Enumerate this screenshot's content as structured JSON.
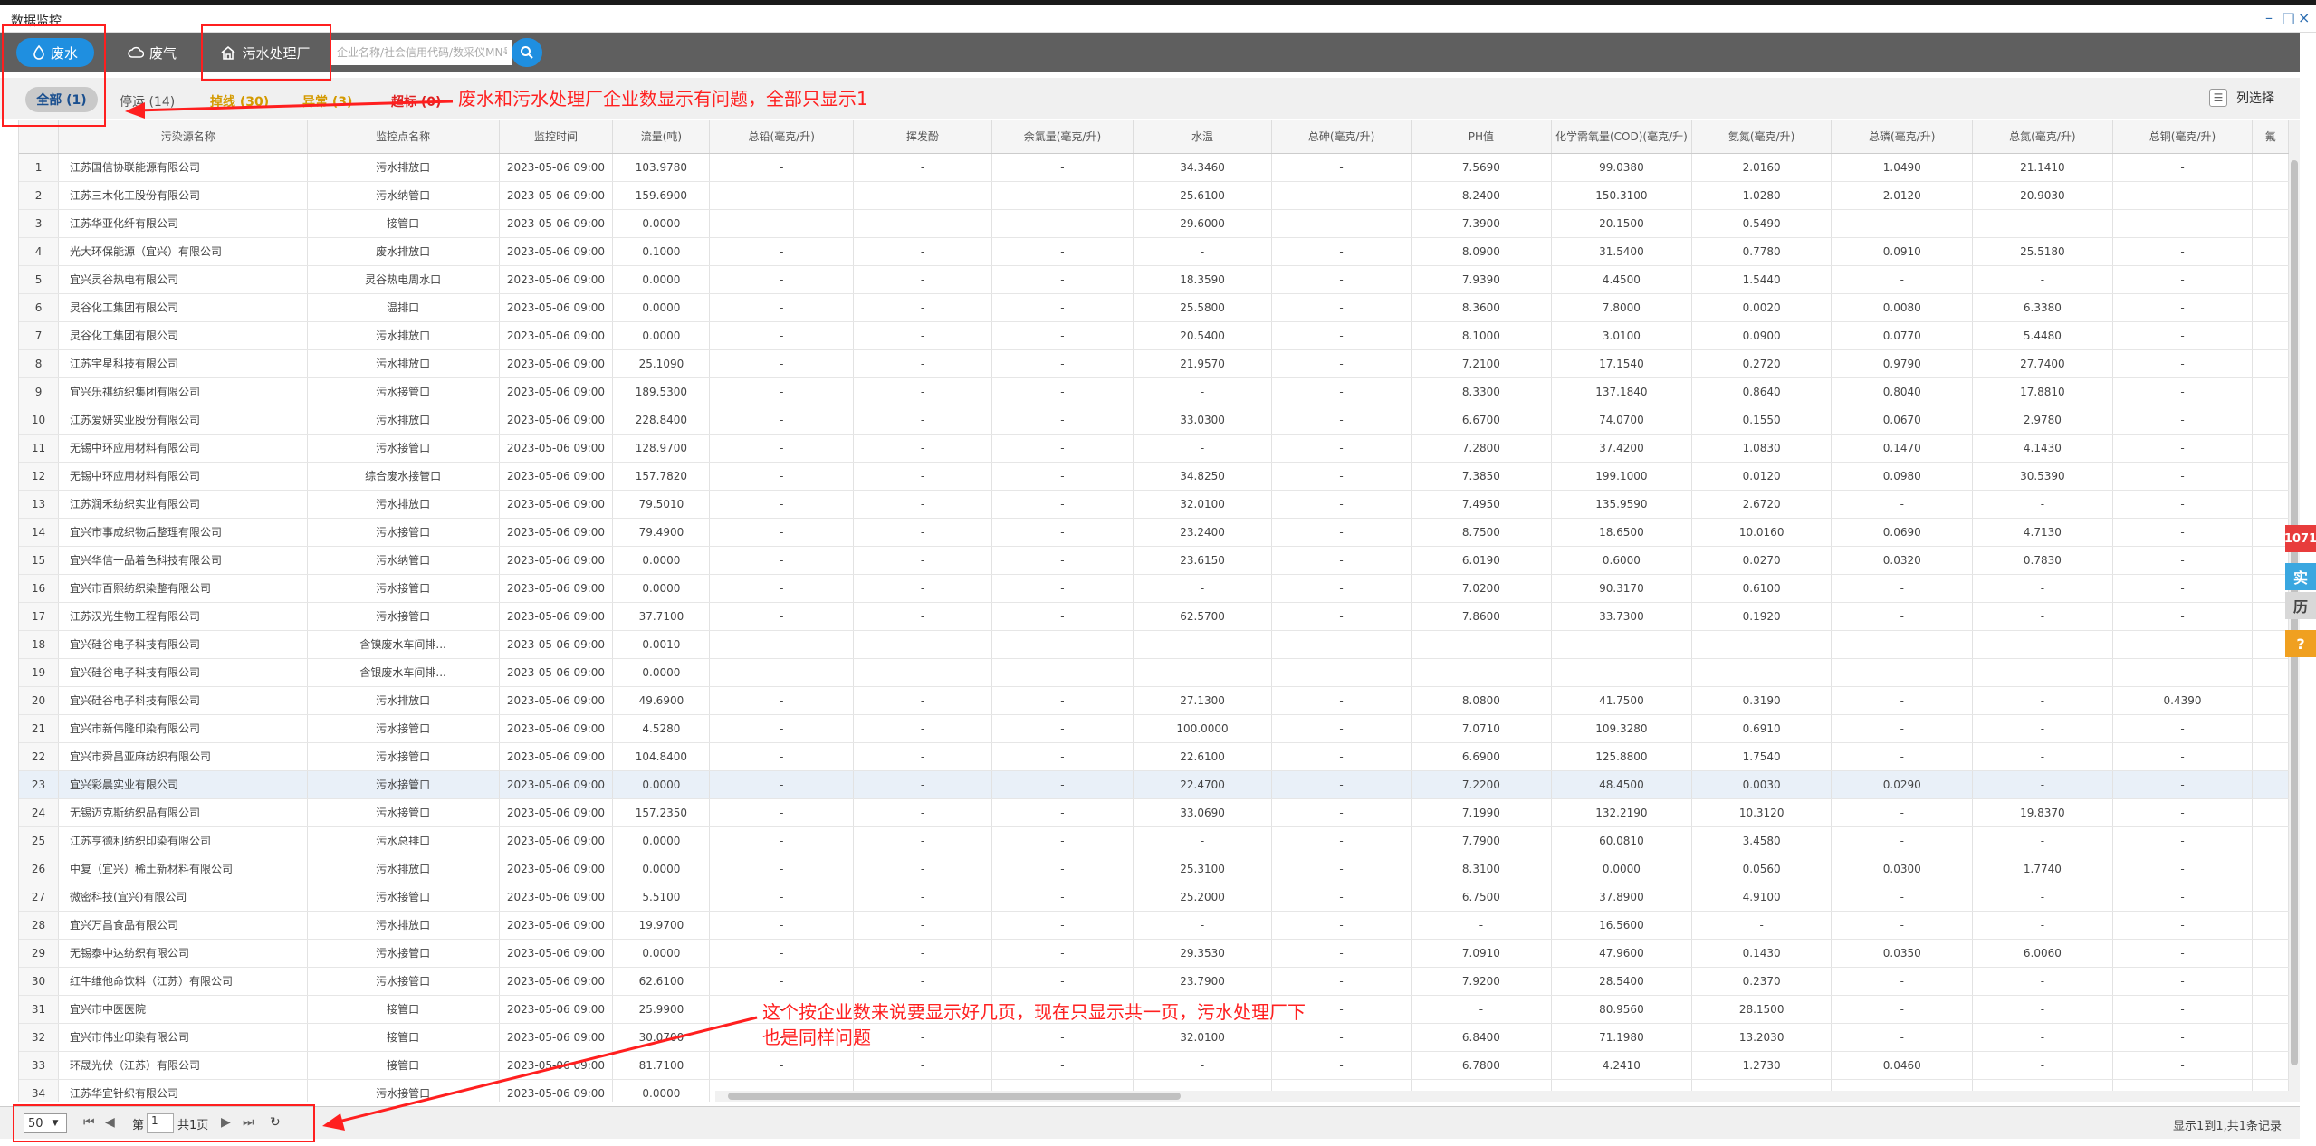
{
  "window": {
    "title": "数据监控",
    "minimize": "–",
    "restore": "□",
    "close": "×"
  },
  "toolbar": {
    "tab_wastewater": "废水",
    "tab_exhaust": "废气",
    "tab_plant": "污水处理厂",
    "search_placeholder": "企业名称/社会信用代码/数采仪MN号"
  },
  "filters": {
    "all": "全部 (1)",
    "stopped": "停运 (14)",
    "offline": "掉线 (30)",
    "abnormal": "异常 (3)",
    "exceed": "超标 (0)",
    "column_select": "列选择",
    "colors": {
      "stopped": "#555555",
      "offline": "#d49a00",
      "abnormal": "#d49a00",
      "exceed": "#e02020"
    }
  },
  "table": {
    "headers": [
      "",
      "污染源名称",
      "监控点名称",
      "监控时间",
      "流量(吨)",
      "总铅(毫克/升)",
      "挥发酚",
      "余氯量(毫克/升)",
      "水温",
      "总砷(毫克/升)",
      "PH值",
      "化学需氧量(COD)(毫克/升)",
      "氨氮(毫克/升)",
      "总磷(毫克/升)",
      "总氮(毫克/升)",
      "总铜(毫克/升)",
      "氟"
    ],
    "rows": [
      [
        "1",
        "江苏国信协联能源有限公司",
        "污水排放口",
        "2023-05-06 09:00",
        "103.9780",
        "-",
        "-",
        "-",
        "34.3460",
        "-",
        "7.5690",
        "99.0380",
        "2.0160",
        "1.0490",
        "21.1410",
        "-"
      ],
      [
        "2",
        "江苏三木化工股份有限公司",
        "污水纳管口",
        "2023-05-06 09:00",
        "159.6900",
        "-",
        "-",
        "-",
        "25.6100",
        "-",
        "8.2400",
        "150.3100",
        "1.0280",
        "2.0120",
        "20.9030",
        "-"
      ],
      [
        "3",
        "江苏华亚化纤有限公司",
        "接管口",
        "2023-05-06 09:00",
        "0.0000",
        "-",
        "-",
        "-",
        "29.6000",
        "-",
        "7.3900",
        "20.1500",
        "0.5490",
        "-",
        "-",
        "-"
      ],
      [
        "4",
        "光大环保能源（宜兴）有限公司",
        "废水排放口",
        "2023-05-06 09:00",
        "0.1000",
        "-",
        "-",
        "-",
        "-",
        "-",
        "8.0900",
        "31.5400",
        "0.7780",
        "0.0910",
        "25.5180",
        "-"
      ],
      [
        "5",
        "宜兴灵谷热电有限公司",
        "灵谷热电周水口",
        "2023-05-06 09:00",
        "0.0000",
        "-",
        "-",
        "-",
        "18.3590",
        "-",
        "7.9390",
        "4.4500",
        "1.5440",
        "-",
        "-",
        "-"
      ],
      [
        "6",
        "灵谷化工集团有限公司",
        "温排口",
        "2023-05-06 09:00",
        "0.0000",
        "-",
        "-",
        "-",
        "25.5800",
        "-",
        "8.3600",
        "7.8000",
        "0.0020",
        "0.0080",
        "6.3380",
        "-"
      ],
      [
        "7",
        "灵谷化工集团有限公司",
        "污水排放口",
        "2023-05-06 09:00",
        "0.0000",
        "-",
        "-",
        "-",
        "20.5400",
        "-",
        "8.1000",
        "3.0100",
        "0.0900",
        "0.0770",
        "5.4480",
        "-"
      ],
      [
        "8",
        "江苏宇星科技有限公司",
        "污水排放口",
        "2023-05-06 09:00",
        "25.1090",
        "-",
        "-",
        "-",
        "21.9570",
        "-",
        "7.2100",
        "17.1540",
        "0.2720",
        "0.9790",
        "27.7400",
        "-"
      ],
      [
        "9",
        "宜兴乐祺纺织集团有限公司",
        "污水接管口",
        "2023-05-06 09:00",
        "189.5300",
        "-",
        "-",
        "-",
        "-",
        "-",
        "8.3300",
        "137.1840",
        "0.8640",
        "0.8040",
        "17.8810",
        "-"
      ],
      [
        "10",
        "江苏爱妍实业股份有限公司",
        "污水排放口",
        "2023-05-06 09:00",
        "228.8400",
        "-",
        "-",
        "-",
        "33.0300",
        "-",
        "6.6700",
        "74.0700",
        "0.1550",
        "0.0670",
        "2.9780",
        "-"
      ],
      [
        "11",
        "无锡中环应用材料有限公司",
        "污水接管口",
        "2023-05-06 09:00",
        "128.9700",
        "-",
        "-",
        "-",
        "-",
        "-",
        "7.2800",
        "37.4200",
        "1.0830",
        "0.1470",
        "4.1430",
        "-"
      ],
      [
        "12",
        "无锡中环应用材料有限公司",
        "综合废水接管口",
        "2023-05-06 09:00",
        "157.7820",
        "-",
        "-",
        "-",
        "34.8250",
        "-",
        "7.3850",
        "199.1000",
        "0.0120",
        "0.0980",
        "30.5390",
        "-"
      ],
      [
        "13",
        "江苏润禾纺织实业有限公司",
        "污水排放口",
        "2023-05-06 09:00",
        "79.5010",
        "-",
        "-",
        "-",
        "32.0100",
        "-",
        "7.4950",
        "135.9590",
        "2.6720",
        "-",
        "-",
        "-"
      ],
      [
        "14",
        "宜兴市事成织物后整理有限公司",
        "污水接管口",
        "2023-05-06 09:00",
        "79.4900",
        "-",
        "-",
        "-",
        "23.2400",
        "-",
        "8.7500",
        "18.6500",
        "10.0160",
        "0.0690",
        "4.7130",
        "-"
      ],
      [
        "15",
        "宜兴华信一品着色科技有限公司",
        "污水纳管口",
        "2023-05-06 09:00",
        "0.0000",
        "-",
        "-",
        "-",
        "23.6150",
        "-",
        "6.0190",
        "0.6000",
        "0.0270",
        "0.0320",
        "0.7830",
        "-"
      ],
      [
        "16",
        "宜兴市百熙纺织染整有限公司",
        "污水接管口",
        "2023-05-06 09:00",
        "0.0000",
        "-",
        "-",
        "-",
        "-",
        "-",
        "7.0200",
        "90.3170",
        "0.6100",
        "-",
        "-",
        "-"
      ],
      [
        "17",
        "江苏汉光生物工程有限公司",
        "污水接管口",
        "2023-05-06 09:00",
        "37.7100",
        "-",
        "-",
        "-",
        "62.5700",
        "-",
        "7.8600",
        "33.7300",
        "0.1920",
        "-",
        "-",
        "-"
      ],
      [
        "18",
        "宜兴硅谷电子科技有限公司",
        "含镍废水车间排...",
        "2023-05-06 09:00",
        "0.0010",
        "-",
        "-",
        "-",
        "-",
        "-",
        "-",
        "-",
        "-",
        "-",
        "-",
        "-"
      ],
      [
        "19",
        "宜兴硅谷电子科技有限公司",
        "含银废水车间排...",
        "2023-05-06 09:00",
        "0.0000",
        "-",
        "-",
        "-",
        "-",
        "-",
        "-",
        "-",
        "-",
        "-",
        "-",
        "-"
      ],
      [
        "20",
        "宜兴硅谷电子科技有限公司",
        "污水排放口",
        "2023-05-06 09:00",
        "49.6900",
        "-",
        "-",
        "-",
        "27.1300",
        "-",
        "8.0800",
        "41.7500",
        "0.3190",
        "-",
        "-",
        "0.4390"
      ],
      [
        "21",
        "宜兴市新伟隆印染有限公司",
        "污水接管口",
        "2023-05-06 09:00",
        "4.5280",
        "-",
        "-",
        "-",
        "100.0000",
        "-",
        "7.0710",
        "109.3280",
        "0.6910",
        "-",
        "-",
        "-"
      ],
      [
        "22",
        "宜兴市舜昌亚麻纺织有限公司",
        "污水接管口",
        "2023-05-06 09:00",
        "104.8400",
        "-",
        "-",
        "-",
        "22.6100",
        "-",
        "6.6900",
        "125.8800",
        "1.7540",
        "-",
        "-",
        "-"
      ],
      [
        "23",
        "宜兴彩晨实业有限公司",
        "污水接管口",
        "2023-05-06 09:00",
        "0.0000",
        "-",
        "-",
        "-",
        "22.4700",
        "-",
        "7.2200",
        "48.4500",
        "0.0030",
        "0.0290",
        "-",
        "-"
      ],
      [
        "24",
        "无锡迈克斯纺织品有限公司",
        "污水接管口",
        "2023-05-06 09:00",
        "157.2350",
        "-",
        "-",
        "-",
        "33.0690",
        "-",
        "7.1990",
        "132.2190",
        "10.3120",
        "-",
        "19.8370",
        "-"
      ],
      [
        "25",
        "江苏亨德利纺织印染有限公司",
        "污水总排口",
        "2023-05-06 09:00",
        "0.0000",
        "-",
        "-",
        "-",
        "-",
        "-",
        "7.7900",
        "60.0810",
        "3.4580",
        "-",
        "-",
        "-"
      ],
      [
        "26",
        "中复（宜兴）稀土新材料有限公司",
        "污水排放口",
        "2023-05-06 09:00",
        "0.0000",
        "-",
        "-",
        "-",
        "25.3100",
        "-",
        "8.3100",
        "0.0000",
        "0.0560",
        "0.0300",
        "1.7740",
        "-"
      ],
      [
        "27",
        "微密科技(宜兴)有限公司",
        "污水接管口",
        "2023-05-06 09:00",
        "5.5100",
        "-",
        "-",
        "-",
        "25.2000",
        "-",
        "6.7500",
        "37.8900",
        "4.9100",
        "-",
        "-",
        "-"
      ],
      [
        "28",
        "宜兴万昌食品有限公司",
        "污水排放口",
        "2023-05-06 09:00",
        "19.9700",
        "-",
        "-",
        "-",
        "-",
        "-",
        "-",
        "16.5600",
        "-",
        "-",
        "-",
        "-"
      ],
      [
        "29",
        "无锡泰中达纺织有限公司",
        "污水接管口",
        "2023-05-06 09:00",
        "0.0000",
        "-",
        "-",
        "-",
        "29.3530",
        "-",
        "7.0910",
        "47.9600",
        "0.1430",
        "0.0350",
        "6.0060",
        "-"
      ],
      [
        "30",
        "红牛维他命饮料（江苏）有限公司",
        "污水接管口",
        "2023-05-06 09:00",
        "62.6100",
        "-",
        "-",
        "-",
        "23.7900",
        "-",
        "7.9200",
        "28.5400",
        "0.2370",
        "-",
        "-",
        "-"
      ],
      [
        "31",
        "宜兴市中医医院",
        "接管口",
        "2023-05-06 09:00",
        "25.9900",
        "-",
        "-",
        "-",
        "-",
        "-",
        "-",
        "80.9560",
        "28.1500",
        "-",
        "-",
        "-"
      ],
      [
        "32",
        "宜兴市伟业印染有限公司",
        "接管口",
        "2023-05-06 09:00",
        "30.0700",
        "-",
        "-",
        "-",
        "32.0100",
        "-",
        "6.8400",
        "71.1980",
        "13.2030",
        "-",
        "-",
        "-"
      ],
      [
        "33",
        "环晟光伏（江苏）有限公司",
        "接管口",
        "2023-05-06 09:00",
        "81.7100",
        "-",
        "-",
        "-",
        "-",
        "-",
        "6.7800",
        "4.2410",
        "1.2730",
        "0.0460",
        "-",
        "-"
      ],
      [
        "34",
        "江苏华宜针织有限公司",
        "污水接管口",
        "2023-05-06 09:00",
        "0.0000",
        "-",
        "-",
        "-",
        "-",
        "-",
        "-",
        "-",
        "-",
        "-",
        "-",
        "-"
      ]
    ]
  },
  "side_tabs": [
    "1071",
    "实",
    "历",
    "?"
  ],
  "pager": {
    "page_size": "50",
    "page_prefix": "第",
    "page_value": "1",
    "total_pages": "共1页",
    "info": "显示1到1,共1条记录"
  },
  "annotations": {
    "note1": "废水和污水处理厂企业数显示有问题，全部只显示1",
    "note2_line1": "这个按企业数来说要显示好几页，现在只显示共一页，污水处理厂下",
    "note2_line2": "也是同样问题"
  },
  "colors": {
    "accent": "#1f8fe0",
    "toolbar": "#5f5f5f",
    "annotation": "#ff1f1f"
  }
}
